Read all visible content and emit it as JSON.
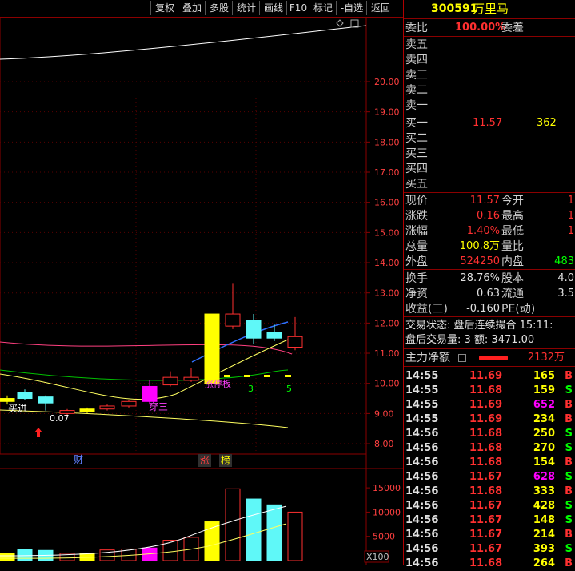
{
  "toolbar": {
    "buttons": [
      "复权",
      "叠加",
      "多股",
      "统计",
      "画线",
      "F10",
      "标记",
      "-自选",
      "返回"
    ]
  },
  "chart": {
    "price_axis": [
      "20.00",
      "19.00",
      "18.00",
      "17.00",
      "16.00",
      "15.00",
      "14.00",
      "13.00",
      "12.00",
      "11.00",
      "10.00",
      "9.00",
      "8.00"
    ],
    "volume_axis": [
      "15000",
      "10000",
      "5000"
    ],
    "volume_unit": "X100",
    "annotations": {
      "buy_in": "买进",
      "buy_value": "0.07",
      "through_three": "穿三",
      "limit_up_board": "涨停板",
      "count_3": "3",
      "count_5": "5"
    },
    "markers": {
      "finance": "财",
      "limit": "涨",
      "list": "榜"
    }
  },
  "chart_data": {
    "type": "candlestick",
    "price_ylim": [
      7.6,
      20.5
    ],
    "candles": [
      {
        "open": 9.4,
        "close": 9.5,
        "high": 9.6,
        "low": 9.3,
        "color": "yellow"
      },
      {
        "open": 9.5,
        "close": 9.7,
        "high": 9.8,
        "low": 9.45,
        "color": "cyan"
      },
      {
        "open": 9.35,
        "close": 9.55,
        "high": 9.6,
        "low": 9.1,
        "color": "cyan"
      },
      {
        "open": 9.1,
        "close": 9.0,
        "high": 9.15,
        "low": 8.9,
        "color": "red"
      },
      {
        "open": 9.15,
        "close": 9.05,
        "high": 9.2,
        "low": 9.0,
        "color": "yellow"
      },
      {
        "open": 9.25,
        "close": 9.15,
        "high": 9.3,
        "low": 9.1,
        "color": "red"
      },
      {
        "open": 9.4,
        "close": 9.25,
        "high": 9.45,
        "low": 9.2,
        "color": "red"
      },
      {
        "open": 9.9,
        "close": 9.4,
        "high": 10.1,
        "low": 9.3,
        "color": "magenta"
      },
      {
        "open": 9.95,
        "close": 10.2,
        "high": 10.4,
        "low": 9.9,
        "color": "red"
      },
      {
        "open": 10.1,
        "close": 10.2,
        "high": 10.5,
        "low": 10.05,
        "color": "red"
      },
      {
        "open": 10.0,
        "close": 12.3,
        "high": 12.3,
        "low": 10.0,
        "color": "yellow"
      },
      {
        "open": 11.9,
        "close": 12.3,
        "high": 13.3,
        "low": 11.8,
        "color": "red"
      },
      {
        "open": 11.5,
        "close": 12.1,
        "high": 12.3,
        "low": 11.3,
        "color": "cyan"
      },
      {
        "open": 11.5,
        "close": 11.7,
        "high": 11.95,
        "low": 11.4,
        "color": "cyan"
      },
      {
        "open": 11.55,
        "close": 11.2,
        "high": 12.2,
        "low": 11.1,
        "color": "red"
      }
    ],
    "volumes": [
      1500,
      2300,
      2100,
      1500,
      1500,
      2200,
      2400,
      2600,
      4200,
      4800,
      8000,
      14800,
      12700,
      11500,
      10000
    ],
    "volume_ylim": [
      0,
      17000
    ]
  },
  "quote": {
    "code": "300591",
    "name": "万里马",
    "weibi_label": "委比",
    "weibi_value": "100.00%",
    "weicha_label": "委差",
    "sell_labels": [
      "卖五",
      "卖四",
      "卖三",
      "卖二",
      "卖一"
    ],
    "buy_labels": [
      "买一",
      "买二",
      "买三",
      "买四",
      "买五"
    ],
    "buy1_price": "11.57",
    "buy1_vol": "362",
    "stats": [
      {
        "l1": "现价",
        "v1": "11.57",
        "l2": "今开",
        "v2": "1"
      },
      {
        "l1": "涨跌",
        "v1": "0.16",
        "l2": "最高",
        "v2": "1"
      },
      {
        "l1": "涨幅",
        "v1": "1.40%",
        "l2": "最低",
        "v2": "1"
      },
      {
        "l1": "总量",
        "v1": "100.8万",
        "l2": "量比",
        "v2": ""
      },
      {
        "l1": "外盘",
        "v1": "524250",
        "l2": "内盘",
        "v2": "483"
      }
    ],
    "stats2": [
      {
        "l1": "换手",
        "v1": "28.76%",
        "l2": "股本",
        "v2": "4.0"
      },
      {
        "l1": "净资",
        "v1": "0.63",
        "l2": "流通",
        "v2": "3.5"
      },
      {
        "l1": "收益(三)",
        "v1": "-0.160",
        "l2": "PE(动)",
        "v2": ""
      }
    ],
    "trade_status": "交易状态: 盘后连续撮合 15:11:",
    "after_trade": "盘后交易量: 3  额: 3471.00",
    "main_net_label": "主力净额",
    "main_net_value": "2132万"
  },
  "ticks": [
    {
      "t": "14:55",
      "p": "11.69",
      "v": "165",
      "s": "B"
    },
    {
      "t": "14:55",
      "p": "11.68",
      "v": "159",
      "s": "S"
    },
    {
      "t": "14:55",
      "p": "11.69",
      "v": "652",
      "s": "B"
    },
    {
      "t": "14:55",
      "p": "11.69",
      "v": "234",
      "s": "B"
    },
    {
      "t": "14:56",
      "p": "11.68",
      "v": "250",
      "s": "S"
    },
    {
      "t": "14:56",
      "p": "11.68",
      "v": "270",
      "s": "S"
    },
    {
      "t": "14:56",
      "p": "11.68",
      "v": "154",
      "s": "B"
    },
    {
      "t": "14:56",
      "p": "11.67",
      "v": "628",
      "s": "S"
    },
    {
      "t": "14:56",
      "p": "11.68",
      "v": "333",
      "s": "B"
    },
    {
      "t": "14:56",
      "p": "11.67",
      "v": "428",
      "s": "S"
    },
    {
      "t": "14:56",
      "p": "11.67",
      "v": "148",
      "s": "S"
    },
    {
      "t": "14:56",
      "p": "11.67",
      "v": "214",
      "s": "B"
    },
    {
      "t": "14:56",
      "p": "11.67",
      "v": "393",
      "s": "S"
    },
    {
      "t": "14:56",
      "p": "11.68",
      "v": "264",
      "s": "B"
    }
  ]
}
